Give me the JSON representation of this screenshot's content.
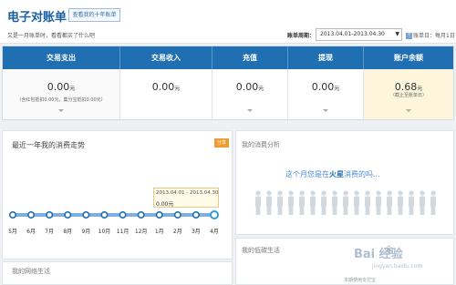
{
  "header": {
    "title": "电子对账单",
    "ten_year_link": "查看我的十年账单",
    "tip": "又是一月账单时，看看都买了什么吧",
    "period_label": "账单周期：",
    "period_value": "2013.04.01-2013.04.30",
    "bill_day": "账单日：每月1日"
  },
  "summary": {
    "columns": [
      {
        "title": "交易支出",
        "amount": "0.00",
        "unit": "元",
        "note": "（含红包抵扣0.00元，集分宝抵扣0.00元）"
      },
      {
        "title": "交易收入",
        "amount": "0.00",
        "unit": "元",
        "note": ""
      },
      {
        "title": "充值",
        "amount": "0.00",
        "unit": "元",
        "note": ""
      },
      {
        "title": "提现",
        "amount": "0.00",
        "unit": "元",
        "note": ""
      },
      {
        "title": "账户余额",
        "amount": "0.68",
        "unit": "元",
        "note": "（截止至账单日）"
      }
    ]
  },
  "trend": {
    "title": "最近一年我的消费走势",
    "share_label": "分享",
    "tooltip_date": "2013.04.01 - 2013.04.30",
    "tooltip_value": "0.00元"
  },
  "chart_data": {
    "type": "line",
    "title": "最近一年我的消费走势",
    "categories": [
      "5月",
      "6月",
      "7月",
      "8月",
      "9月",
      "10月",
      "11月",
      "12月",
      "1月",
      "2月",
      "3月",
      "4月"
    ],
    "values": [
      0,
      0,
      0,
      0,
      0,
      0,
      0,
      0,
      0,
      0,
      0,
      0
    ],
    "xlabel": "",
    "ylabel": "",
    "highlight_index": 11,
    "line_color": "#7fb0dc",
    "point_color": "#1f6fb2",
    "grid": false
  },
  "analysis": {
    "title": "我的消费分析",
    "question_prefix": "这个月您是在",
    "question_em": "火星",
    "question_suffix": "消费的吗...",
    "people_count": 17
  },
  "low_carbon": {
    "title": "我的低碳生活",
    "footer": "本期使用支付宝"
  },
  "network": {
    "title": "我的网络生活"
  },
  "watermark": {
    "brand": "Bai   经验",
    "url": "jingyan.baidu.com"
  },
  "colors": {
    "accent": "#1f6fb2",
    "share": "#f19a2e",
    "highlight_cell": "#fdf6dc"
  }
}
